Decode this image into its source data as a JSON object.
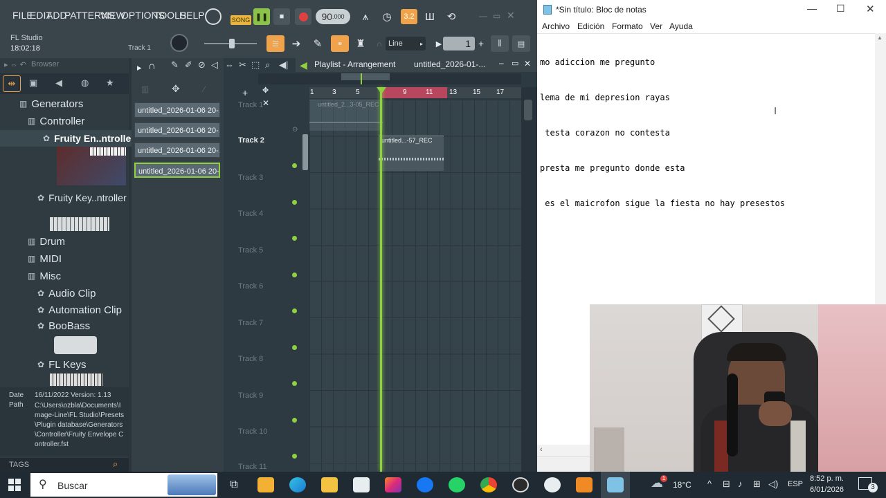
{
  "fl": {
    "menu": [
      "FILE",
      "EDIT",
      "ADD",
      "PATTERNS",
      "VIEW",
      "OPTIONS",
      "TOOLS",
      "HELP"
    ],
    "song_label": "SONG",
    "tempo": "90",
    "tempo_decimal": ".000",
    "pattern_counter": "3.2",
    "app_name": "FL Studio",
    "time": "18:02:18",
    "track_hint": "Track 1",
    "snap": "Line",
    "pattern_num": "1",
    "browser_label": "Browser",
    "playlist_title": "Playlist - Arrangement",
    "playlist_file": "untitled_2026-01-...",
    "browser_tree": [
      {
        "label": "Generators",
        "level": 0,
        "icon": "folder-icon"
      },
      {
        "label": "Controller",
        "level": 1,
        "icon": "folder-icon"
      },
      {
        "label": "Fruity En..ntroller",
        "level": 2,
        "icon": "plugin-icon",
        "selected": true
      },
      {
        "label": "Fruity Key..ntroller",
        "level": 2,
        "icon": "plugin-icon"
      },
      {
        "label": "Drum",
        "level": 1,
        "icon": "folder-icon"
      },
      {
        "label": "MIDI",
        "level": 1,
        "icon": "folder-icon"
      },
      {
        "label": "Misc",
        "level": 1,
        "icon": "folder-icon"
      },
      {
        "label": "Audio Clip",
        "level": 2,
        "icon": "plugin-icon"
      },
      {
        "label": "Automation Clip",
        "level": 2,
        "icon": "plugin-icon"
      },
      {
        "label": "BooBass",
        "level": 2,
        "icon": "plugin-icon"
      },
      {
        "label": "FL Keys",
        "level": 2,
        "icon": "plugin-icon"
      }
    ],
    "info": {
      "date_label": "Date",
      "date": "16/11/2022 Version: 1.13",
      "path_label": "Path",
      "path": "C:\\Users\\ozbla\\Documents\\Image-Line\\FL Studio\\Presets\\Plugin database\\Generators\\Controller\\Fruity Envelope Controller.fst"
    },
    "tags_label": "TAGS",
    "patterns": [
      "untitled_2026-01-06 20-...",
      "untitled_2026-01-06 20-...",
      "untitled_2026-01-06 20-...",
      "untitled_2026-01-06 20-..."
    ],
    "ruler": [
      "1",
      "3",
      "5",
      "7",
      "9",
      "11",
      "13",
      "15",
      "17"
    ],
    "tracks": [
      "Track 1",
      "Track 2",
      "Track 3",
      "Track 4",
      "Track 5",
      "Track 6",
      "Track 7",
      "Track 8",
      "Track 9",
      "Track 10",
      "Track 11"
    ],
    "clips": [
      {
        "label": "untitled_2...3-05_REC"
      },
      {
        "label": "untitled...-57_REC"
      }
    ]
  },
  "notepad": {
    "title": "*Sin título: Bloc de notas",
    "menu": [
      "Archivo",
      "Edición",
      "Formato",
      "Ver",
      "Ayuda"
    ],
    "lines": [
      "mo adiccion me pregunto",
      "lema de mi depresion rayas",
      " testa corazon no contesta",
      "presta me pregunto donde esta",
      " es el maicrofon sigue la fiesta no hay presestos"
    ]
  },
  "taskbar": {
    "search_placeholder": "Buscar",
    "weather": "18°C",
    "language": "ESP",
    "time": "8:52 p. m.",
    "date": "6/01/2026",
    "notif_count": "3",
    "weather_badge": "1"
  },
  "colors": {
    "fl_bg": "#2b353c",
    "fl_accent": "#8fd13f",
    "fl_orange": "#f0a34a",
    "rec_red": "#e04040",
    "taskbar": "#1f2a33"
  }
}
